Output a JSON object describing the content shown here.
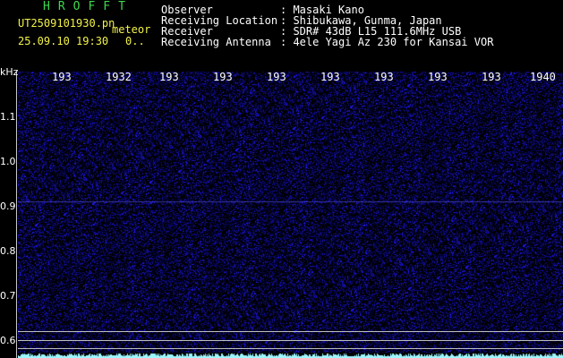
{
  "header": {
    "logo": "HROFFT",
    "filename": "UT2509101930.pn",
    "mode": "meteor",
    "datetime": "25.09.10 19:30",
    "count": "0..",
    "info_labels": [
      "Observer",
      "Receiving Location",
      "Receiver",
      "Receiving Antenna"
    ],
    "info_values": [
      ": Masaki Kano",
      ": Shibukawa, Gunma, Japan",
      ": SDR# 43dB L15 111.6MHz USB",
      ": 4ele Yagi Az 230 for Kansai VOR"
    ]
  },
  "spectrogram": {
    "y_unit": "kHz",
    "y_ticks": [
      "1.1",
      "1.0",
      "0.9",
      "0.8",
      "0.7",
      "0.6"
    ],
    "x_ticks": [
      "193",
      "1932",
      "193",
      "193",
      "193",
      "193",
      "193",
      "193",
      "193",
      "1940"
    ],
    "colors": {
      "background": "#000000",
      "noise": "#2a2ad8",
      "trace": "#9ef6ff"
    }
  }
}
